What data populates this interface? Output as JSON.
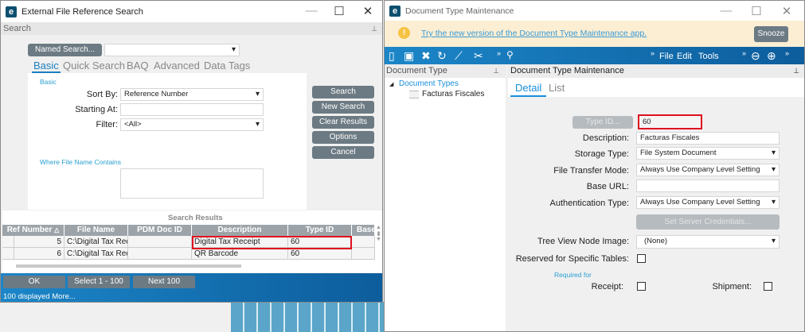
{
  "left_window": {
    "title": "External File Reference Search",
    "panel_header": "Search",
    "named_search_label": "Named Search...",
    "named_search_value": "",
    "tabs": [
      "Basic",
      "Quick Search",
      "BAQ",
      "Advanced",
      "Data Tags"
    ],
    "basic_group": "Basic",
    "sort_by_label": "Sort By:",
    "sort_by_value": "Reference Number",
    "starting_at_label": "Starting At:",
    "starting_at_value": "",
    "filter_label": "Filter:",
    "filter_value": "<All>",
    "where_label": "Where File Name Contains",
    "where_value": "",
    "buttons": [
      "Search",
      "New Search",
      "Clear Results",
      "Options",
      "Cancel"
    ],
    "results_title": "Search Results",
    "columns": [
      "Ref Number",
      "File Name",
      "PDM Doc ID",
      "Description",
      "Type ID",
      "Base"
    ],
    "rows": [
      {
        "ref": "5",
        "file": "C:\\Digital Tax Rec",
        "pdm": "",
        "desc": "Digital Tax Receipt",
        "type": "60"
      },
      {
        "ref": "6",
        "file": "C:\\Digital Tax Rec",
        "pdm": "",
        "desc": "QR Barcode",
        "type": "60"
      }
    ],
    "footer_buttons": [
      "OK",
      "Select 1 - 100",
      "Next 100"
    ],
    "status": "100 displayed More..."
  },
  "right_window": {
    "title": "Document Type Maintenance",
    "banner_link": "Try the new version of the Document Type Maintenance app.",
    "snooze": "Snooze",
    "menus": [
      "File",
      "Edit",
      "Tools"
    ],
    "tree_header": "Document Type",
    "tree_root": "Document Types",
    "tree_child": "Facturas Fiscales",
    "form_header": "Document Type Maintenance",
    "tabs": [
      "Detail",
      "List"
    ],
    "type_id_button": "Type ID...",
    "type_id_value": "60",
    "description_label": "Description:",
    "description_value": "Facturas Fiscales",
    "storage_label": "Storage Type:",
    "storage_value": "File System Document",
    "transfer_label": "File Transfer Mode:",
    "transfer_value": "Always Use Company Level Setting",
    "base_url_label": "Base URL:",
    "base_url_value": "",
    "auth_label": "Authentication Type:",
    "auth_value": "Always Use Company Level Setting",
    "credentials_button": "Set Server Credentials...",
    "tree_image_label": "Tree View Node Image:",
    "tree_image_value": "(None)",
    "reserved_label": "Reserved for Specific Tables:",
    "required_for": "Required for",
    "receipt_label": "Receipt:",
    "shipment_label": "Shipment:"
  },
  "colors": {
    "accent": "#1a7fc1",
    "highlight": "#e0101e",
    "banner": "#fbeed3"
  }
}
